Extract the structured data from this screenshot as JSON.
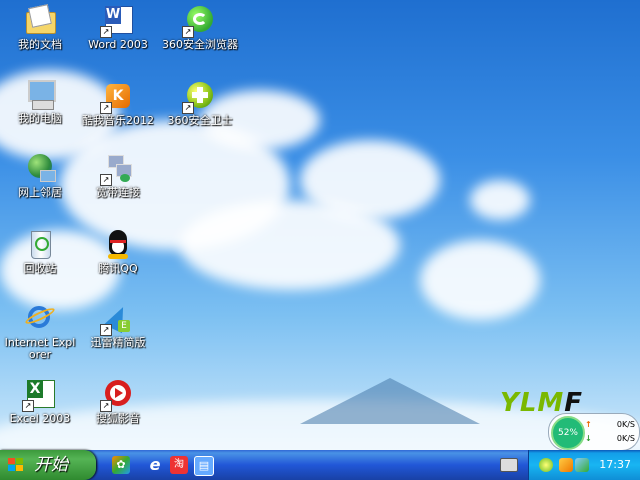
{
  "desktop": {
    "icons": [
      {
        "label": "我的文档",
        "icon": "my-documents-icon"
      },
      {
        "label": "Word 2003",
        "icon": "word-icon"
      },
      {
        "label": "360安全浏览器",
        "icon": "360-browser-icon"
      },
      {
        "label": "我的电脑",
        "icon": "my-computer-icon"
      },
      {
        "label": "酷我音乐2012",
        "icon": "kuwo-music-icon"
      },
      {
        "label": "360安全卫士",
        "icon": "360-safe-icon"
      },
      {
        "label": "网上邻居",
        "icon": "network-places-icon"
      },
      {
        "label": "宽带连接",
        "icon": "broadband-connection-icon"
      },
      {
        "label": "回收站",
        "icon": "recycle-bin-icon"
      },
      {
        "label": "腾讯QQ",
        "icon": "qq-icon"
      },
      {
        "label": "Internet Explorer",
        "icon": "ie-icon"
      },
      {
        "label": "迅雷精简版",
        "icon": "thunder-icon"
      },
      {
        "label": "Excel 2003",
        "icon": "excel-icon"
      },
      {
        "label": "搜狐影音",
        "icon": "sohu-video-icon"
      }
    ],
    "logo": {
      "text_a": "YLM",
      "text_b": "F"
    }
  },
  "net_widget": {
    "cpu": "52%",
    "up": "0K/S",
    "down": "0K/S"
  },
  "taskbar": {
    "start_label": "开始",
    "clock": "17:37"
  }
}
